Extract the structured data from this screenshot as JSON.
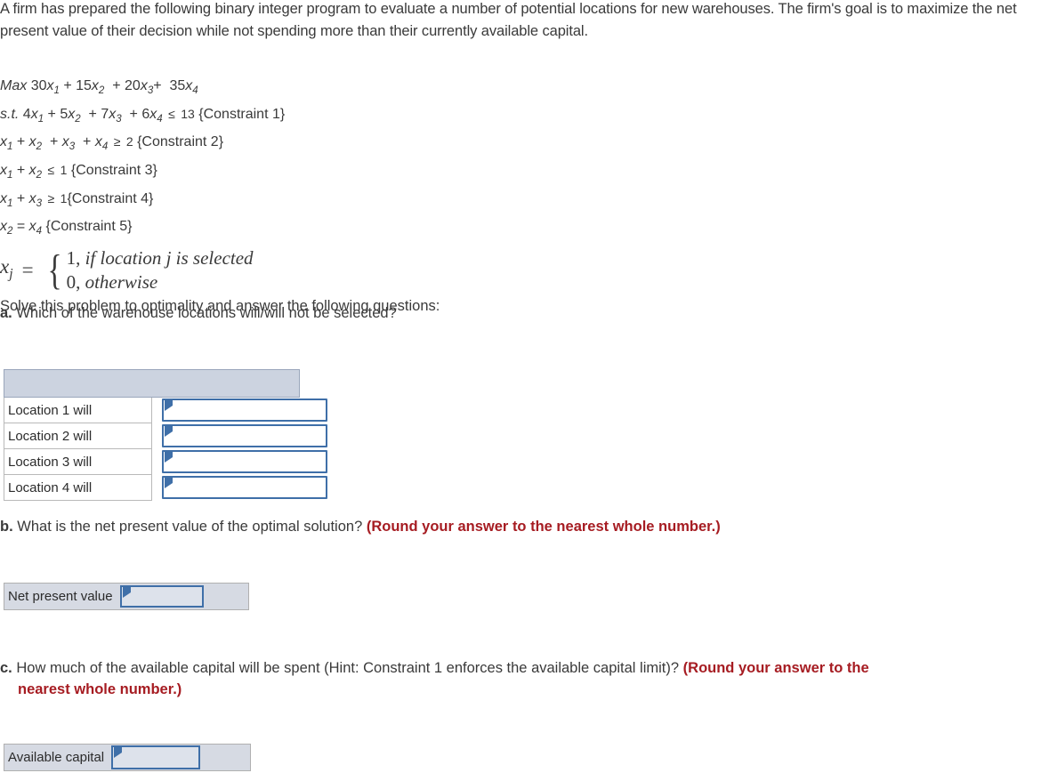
{
  "intro": {
    "paragraph": "A firm has prepared the following binary integer program to evaluate a number of potential locations for new warehouses. The firm's goal is to maximize the net present value of their decision while not spending more than their currently available capital."
  },
  "model": {
    "objective": {
      "keyword": "Max",
      "terms": [
        {
          "coef": "30",
          "var": "x",
          "sub": "1",
          "op": ""
        },
        {
          "coef": "15",
          "var": "x",
          "sub": "2",
          "op": "+"
        },
        {
          "coef": "20",
          "var": "x",
          "sub": "3",
          "op": "+"
        },
        {
          "coef": "35",
          "var": "x",
          "sub": "4",
          "op": "+"
        }
      ]
    },
    "subject_to_keyword": "s.t.",
    "constraints": [
      {
        "terms": [
          {
            "coef": "4",
            "var": "x",
            "sub": "1",
            "op": ""
          },
          {
            "coef": "5",
            "var": "x",
            "sub": "2",
            "op": "+"
          },
          {
            "coef": "7",
            "var": "x",
            "sub": "3",
            "op": "+"
          },
          {
            "coef": "6",
            "var": "x",
            "sub": "4",
            "op": "+"
          }
        ],
        "relation": "≤",
        "rhs": "13",
        "name": "{Constraint 1}"
      },
      {
        "terms": [
          {
            "coef": "",
            "var": "x",
            "sub": "1",
            "op": ""
          },
          {
            "coef": "",
            "var": "x",
            "sub": "2",
            "op": "+"
          },
          {
            "coef": "",
            "var": "x",
            "sub": "3",
            "op": "+"
          },
          {
            "coef": "",
            "var": "x",
            "sub": "4",
            "op": "+"
          }
        ],
        "relation": "≥",
        "rhs": "2",
        "name": "{Constraint 2}"
      },
      {
        "terms": [
          {
            "coef": "",
            "var": "x",
            "sub": "1",
            "op": ""
          },
          {
            "coef": "",
            "var": "x",
            "sub": "2",
            "op": "+"
          }
        ],
        "relation": "≤",
        "rhs": "1",
        "name": "{Constraint 3}"
      },
      {
        "terms": [
          {
            "coef": "",
            "var": "x",
            "sub": "1",
            "op": ""
          },
          {
            "coef": "",
            "var": "x",
            "sub": "3",
            "op": "+"
          }
        ],
        "relation": "≥",
        "rhs": "1",
        "name": "{Constraint 4}"
      },
      {
        "terms": [
          {
            "coef": "",
            "var": "x",
            "sub": "2",
            "op": ""
          },
          {
            "coef": "",
            "var": "x",
            "sub": "4",
            "op": "="
          }
        ],
        "relation": "",
        "rhs": "",
        "name": "{Constraint 5}"
      }
    ],
    "definition": {
      "lhs_var": "x",
      "lhs_sub": "j",
      "equals": "=",
      "case_one": "1, if location j is selected",
      "case_zero": "0, otherwise"
    },
    "solve_instruction": "Solve this problem to optimality and answer the following questions:"
  },
  "questions": {
    "a": {
      "letter": "a.",
      "text": "Which of the warehouse locations will/will not be selected?",
      "table": {
        "header_label": "",
        "rows": [
          {
            "label": "Location 1 will",
            "value": ""
          },
          {
            "label": "Location 2 will",
            "value": ""
          },
          {
            "label": "Location 3 will",
            "value": ""
          },
          {
            "label": "Location 4 will",
            "value": ""
          }
        ]
      }
    },
    "b": {
      "letter": "b.",
      "text": "What is the net present value of the optimal solution?",
      "note": "(Round your answer to the nearest whole number.)",
      "field": {
        "label": "Net present value",
        "value": ""
      }
    },
    "c": {
      "letter": "c.",
      "text": "How much of the available capital will be spent (Hint: Constraint 1 enforces the available capital limit)?",
      "note_line1": "(Round your answer to the",
      "note_line2": "nearest whole number.)",
      "field": {
        "label": "Available capital",
        "value": ""
      }
    }
  },
  "colors": {
    "accent_blue": "#3f6fa8",
    "note_red": "#a61c22",
    "header_fill": "#ccd3e0",
    "field_fill": "#d6dae3",
    "input_fill": "#dde2eb"
  }
}
